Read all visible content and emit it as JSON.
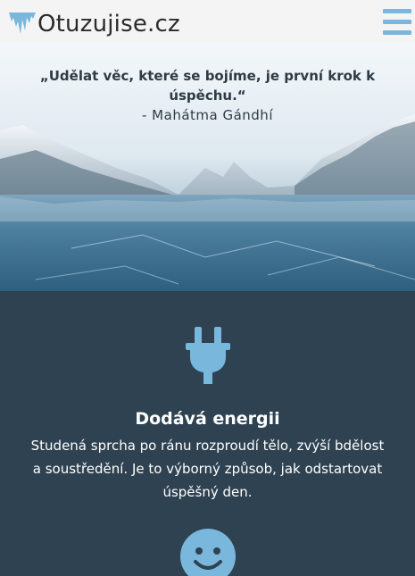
{
  "header": {
    "logo_text": "Otuzujise.cz",
    "logo_icon": "icicle-icon",
    "menu_icon": "hamburger-menu-icon"
  },
  "hero": {
    "quote": "„Udělat věc, které se bojíme, je první krok k úspěchu.“",
    "author": "- Mahátma Gándhí"
  },
  "features": [
    {
      "icon": "plug-icon",
      "title": "Dodává energii",
      "description": "Studená sprcha po ránu rozproudí tělo, zvýší bdělost a soustředění. Je to výborný způsob, jak odstartovat úspěšný den."
    },
    {
      "icon": "smiley-icon",
      "title": "",
      "description": ""
    }
  ],
  "colors": {
    "accent": "#7ab7dc",
    "header_bg": "#f4f4f4",
    "section_bg": "#2e4251",
    "text_dark": "#2b2b2b"
  }
}
